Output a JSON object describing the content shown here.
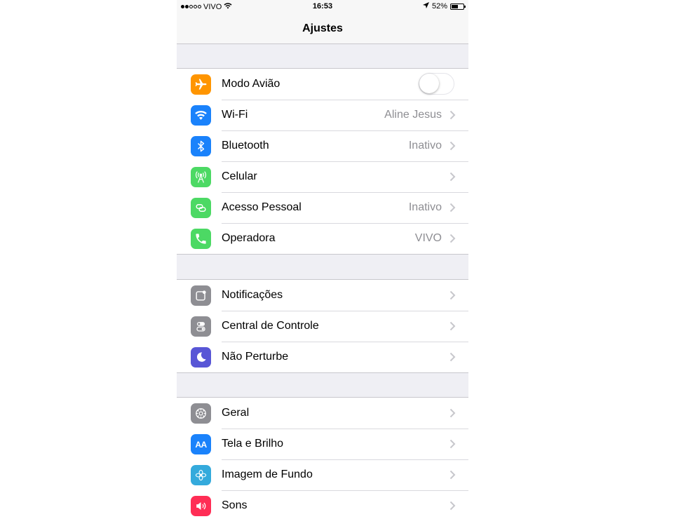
{
  "status": {
    "carrier": "VIVO",
    "time": "16:53",
    "battery": "52%",
    "signal_bars": 2,
    "battery_level": 0.52
  },
  "nav": {
    "title": "Ajustes"
  },
  "groups": [
    {
      "items": [
        {
          "label": "Modo Avião",
          "icon": "airplane-icon",
          "color": "#ff9500",
          "toggle": false
        },
        {
          "label": "Wi-Fi",
          "icon": "wifi-icon",
          "color": "#1a82fb",
          "value": "Aline Jesus"
        },
        {
          "label": "Bluetooth",
          "icon": "bluetooth-icon",
          "color": "#1a82fb",
          "value": "Inativo"
        },
        {
          "label": "Celular",
          "icon": "cellular-antenna-icon",
          "color": "#4cd964"
        },
        {
          "label": "Acesso Pessoal",
          "icon": "personal-hotspot-icon",
          "color": "#4cd964",
          "value": "Inativo"
        },
        {
          "label": "Operadora",
          "icon": "phone-icon",
          "color": "#4cd964",
          "value": "VIVO"
        }
      ]
    },
    {
      "items": [
        {
          "label": "Notificações",
          "icon": "notifications-icon",
          "color": "#8e8e93"
        },
        {
          "label": "Central de Controle",
          "icon": "control-center-icon",
          "color": "#8e8e93"
        },
        {
          "label": "Não Perturbe",
          "icon": "moon-icon",
          "color": "#5856d6"
        }
      ]
    },
    {
      "items": [
        {
          "label": "Geral",
          "icon": "gear-icon",
          "color": "#8e8e93"
        },
        {
          "label": "Tela e Brilho",
          "icon": "display-brightness-icon",
          "color": "#1a82fb",
          "icon_text": "AA"
        },
        {
          "label": "Imagem de Fundo",
          "icon": "wallpaper-icon",
          "color": "#34aadc"
        },
        {
          "label": "Sons",
          "icon": "speaker-icon",
          "color": "#ff2d55"
        }
      ]
    }
  ]
}
